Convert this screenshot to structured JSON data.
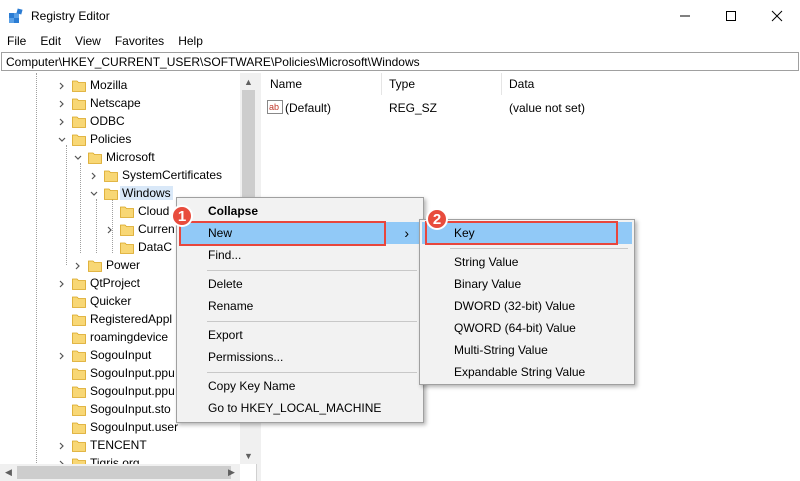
{
  "window": {
    "title": "Registry Editor"
  },
  "menubar": [
    "File",
    "Edit",
    "View",
    "Favorites",
    "Help"
  ],
  "address": "Computer\\HKEY_CURRENT_USER\\SOFTWARE\\Policies\\Microsoft\\Windows",
  "tree": [
    {
      "label": "Mozilla",
      "chevron": "right"
    },
    {
      "label": "Netscape",
      "chevron": "right"
    },
    {
      "label": "ODBC",
      "chevron": "right"
    },
    {
      "label": "Policies",
      "chevron": "down"
    },
    {
      "label": "Microsoft",
      "chevron": "down"
    },
    {
      "label": "SystemCertificates",
      "chevron": "right"
    },
    {
      "label": "Windows",
      "chevron": "down",
      "selected": true
    },
    {
      "label": "Cloud",
      "chevron": ""
    },
    {
      "label": "Curren",
      "chevron": "right"
    },
    {
      "label": "DataC",
      "chevron": ""
    },
    {
      "label": "Power",
      "chevron": "right"
    },
    {
      "label": "QtProject",
      "chevron": "right"
    },
    {
      "label": "Quicker",
      "chevron": ""
    },
    {
      "label": "RegisteredAppl",
      "chevron": ""
    },
    {
      "label": "roamingdevice",
      "chevron": ""
    },
    {
      "label": "SogouInput",
      "chevron": "right"
    },
    {
      "label": "SogouInput.ppu",
      "chevron": ""
    },
    {
      "label": "SogouInput.ppu",
      "chevron": ""
    },
    {
      "label": "SogouInput.sto",
      "chevron": ""
    },
    {
      "label": "SogouInput.user",
      "chevron": ""
    },
    {
      "label": "TENCENT",
      "chevron": "right"
    },
    {
      "label": "Tigris.org",
      "chevron": "right"
    }
  ],
  "list": {
    "columns": [
      "Name",
      "Type",
      "Data"
    ],
    "rows": [
      {
        "name": "(Default)",
        "type": "REG_SZ",
        "data": "(value not set)",
        "icon": "ab-string-icon"
      }
    ]
  },
  "context_menu": {
    "items": [
      "Collapse",
      "New",
      "Find...",
      "Delete",
      "Rename",
      "Export",
      "Permissions...",
      "Copy Key Name",
      "Go to HKEY_LOCAL_MACHINE"
    ],
    "submenu_arrow": "›"
  },
  "submenu": {
    "items": [
      "Key",
      "String Value",
      "Binary Value",
      "DWORD (32-bit) Value",
      "QWORD (64-bit) Value",
      "Multi-String Value",
      "Expandable String Value"
    ]
  },
  "badges": [
    "1",
    "2"
  ],
  "colors": {
    "highlight": "#91c9f7",
    "annotation": "#e8463c",
    "folder": "#f8d775"
  }
}
